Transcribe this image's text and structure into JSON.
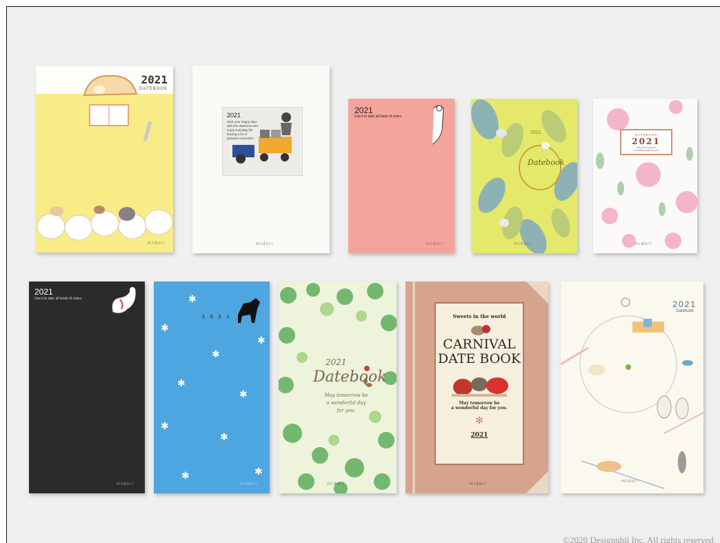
{
  "colors": {
    "background": "#efefef",
    "yellow_cover": "#f8ec86",
    "pink_cover": "#f4a49a",
    "black_cover": "#2b2b2b",
    "blue_cover": "#4ea6e0",
    "tan_cover": "#d6a48e"
  },
  "books": [
    {
      "year": "2021",
      "subtitle": "DATEBOOK",
      "brand": "midori"
    },
    {
      "year": "2021",
      "lines": [
        "Start your happy days",
        "with this datebook and",
        "enjoy everyday life",
        "leaving a lot of",
        "pleasant memories."
      ],
      "brand": "midori"
    },
    {
      "year": "2021",
      "tagline": "Use it to take all kinds of notes.",
      "brand": "midori"
    },
    {
      "year": "2021",
      "title": "Datebook",
      "brand": "midori"
    },
    {
      "subtitle": "DATEBOOK",
      "year": "2021",
      "lines": [
        "May tomorrow be",
        "a wonderful day for you."
      ],
      "brand": "midori"
    },
    {
      "year": "2021",
      "tagline": "Use it to take all kinds of notes.",
      "brand": "midori"
    },
    {
      "year_spaced": "2 0 2 1",
      "brand": "midori"
    },
    {
      "year": "2021",
      "title": "Datebook",
      "lines": [
        "May tomorrow be",
        "a wonderful day",
        "for you."
      ],
      "brand": "midori"
    },
    {
      "header": "Sweets in the world",
      "title_line1": "CARNIVAL",
      "title_line2": "DATE BOOK",
      "lines": [
        "May tomorrow be",
        "a wonderful day for you."
      ],
      "year": "2021",
      "brand": "midori"
    },
    {
      "year": "2021",
      "subtitle": "Datebook",
      "brand": "midori"
    }
  ],
  "footer": {
    "copyright": "©2020 Designphil Inc. All rights reserved."
  }
}
